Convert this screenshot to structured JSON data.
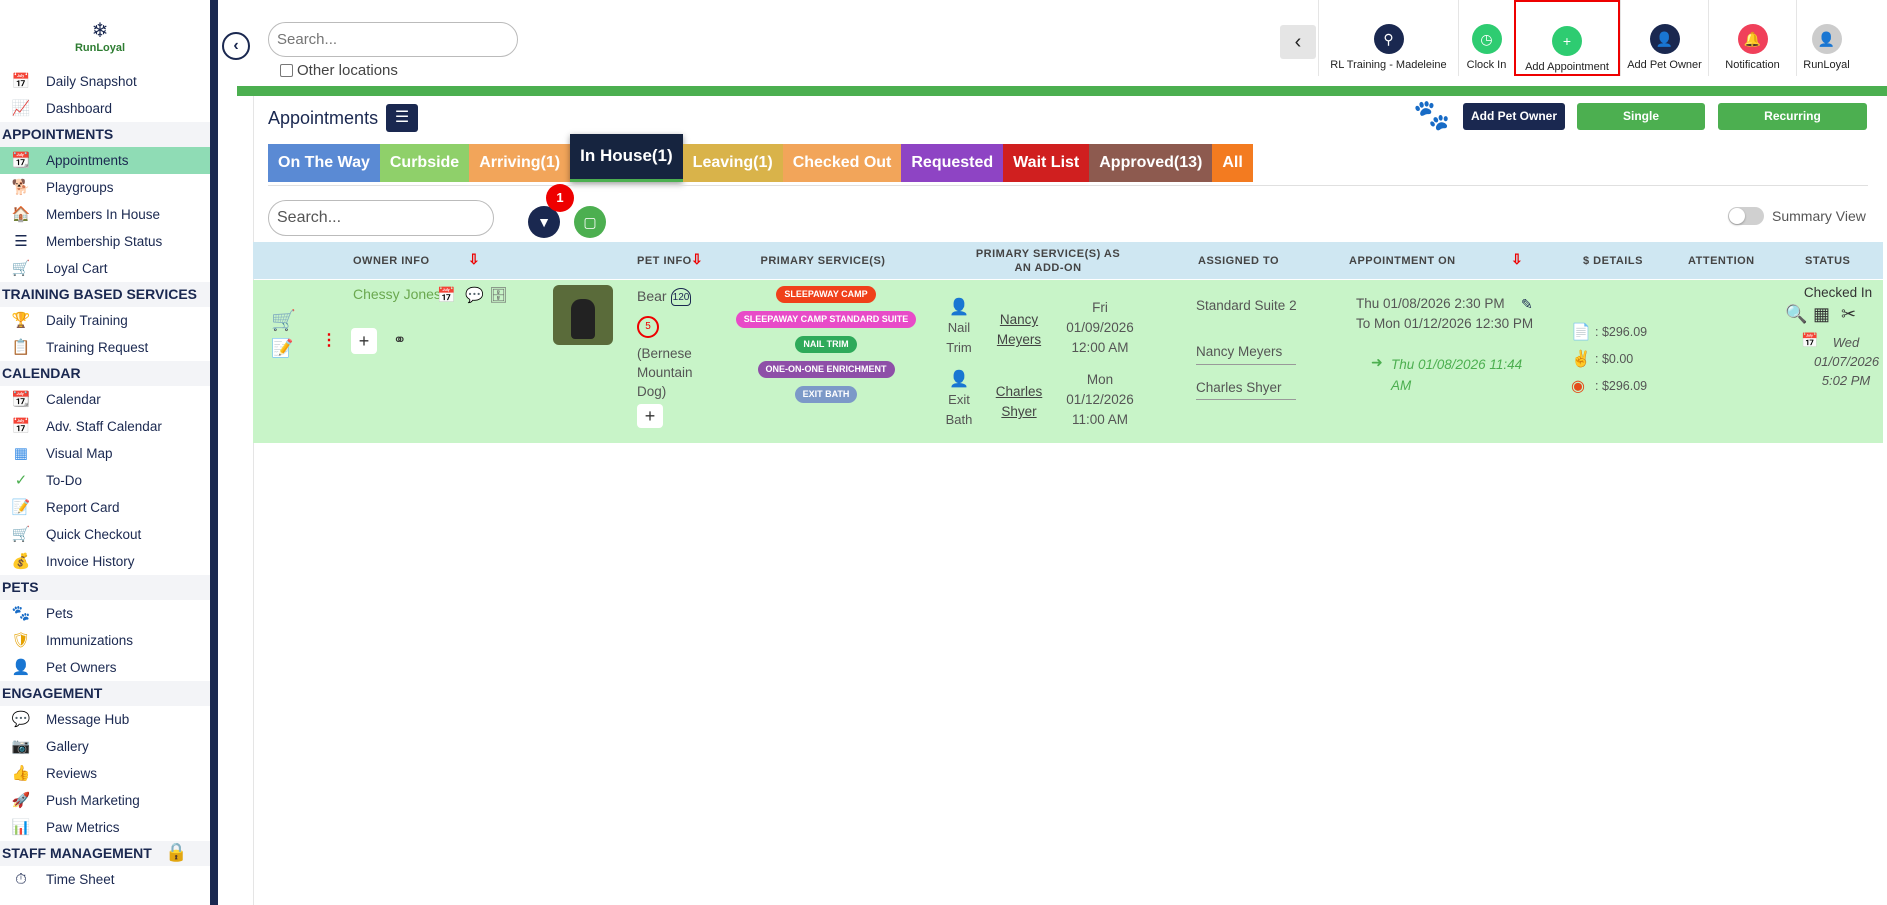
{
  "sidebar": {
    "logo_text": "RunLoyal",
    "sections": [
      {
        "title": "",
        "items": [
          {
            "label": "Daily Snapshot",
            "icon": "today-icon"
          },
          {
            "label": "Dashboard",
            "icon": "dashboard-icon"
          }
        ]
      },
      {
        "title": "APPOINTMENTS",
        "items": [
          {
            "label": "Appointments",
            "icon": "calendar-icon"
          },
          {
            "label": "Playgroups",
            "icon": "dog-icon"
          },
          {
            "label": "Members In House",
            "icon": "house-icon"
          },
          {
            "label": "Membership Status",
            "icon": "membership-icon"
          },
          {
            "label": "Loyal Cart",
            "icon": "cart-icon"
          }
        ]
      },
      {
        "title": "TRAINING BASED SERVICES",
        "items": [
          {
            "label": "Daily Training",
            "icon": "training-icon"
          },
          {
            "label": "Training Request",
            "icon": "request-icon"
          }
        ]
      },
      {
        "title": "CALENDAR",
        "items": [
          {
            "label": "Calendar",
            "icon": "calendar-icon"
          },
          {
            "label": "Adv. Staff Calendar",
            "icon": "staff-calendar-icon"
          },
          {
            "label": "Visual Map",
            "icon": "map-icon"
          },
          {
            "label": "To-Do",
            "icon": "todo-icon"
          },
          {
            "label": "Report Card",
            "icon": "report-icon"
          },
          {
            "label": "Quick Checkout",
            "icon": "checkout-icon"
          },
          {
            "label": "Invoice History",
            "icon": "invoice-icon"
          }
        ]
      },
      {
        "title": "PETS",
        "items": [
          {
            "label": "Pets",
            "icon": "paw-icon"
          },
          {
            "label": "Immunizations",
            "icon": "shield-icon"
          },
          {
            "label": "Pet Owners",
            "icon": "user-icon"
          }
        ]
      },
      {
        "title": "ENGAGEMENT",
        "items": [
          {
            "label": "Message Hub",
            "icon": "message-icon"
          },
          {
            "label": "Gallery",
            "icon": "gallery-icon"
          },
          {
            "label": "Reviews",
            "icon": "thumbs-up-icon"
          },
          {
            "label": "Push Marketing",
            "icon": "rocket-icon"
          },
          {
            "label": "Paw Metrics",
            "icon": "metrics-icon"
          }
        ]
      },
      {
        "title": "STAFF MANAGEMENT",
        "items": [
          {
            "label": "Time Sheet",
            "icon": "timesheet-icon"
          }
        ]
      }
    ]
  },
  "topbar": {
    "search_placeholder": "Search...",
    "other_locations": "Other locations",
    "actions": [
      {
        "label": "RL Training - Madeleine",
        "color": "#1a2850",
        "icon": "location-icon"
      },
      {
        "label": "Clock In",
        "color": "#2ecc71",
        "icon": "clock-icon"
      },
      {
        "label": "Add Appointment",
        "color": "#2ecc71",
        "icon": "add-appointment-icon"
      },
      {
        "label": "Add Pet Owner",
        "color": "#1a2850",
        "icon": "add-user-icon"
      },
      {
        "label": "Notification",
        "color": "#f0405a",
        "icon": "bell-icon"
      },
      {
        "label": "RunLoyal",
        "color": "#cccccc",
        "icon": "avatar-icon"
      }
    ]
  },
  "panel": {
    "title": "Appointments",
    "buttons": {
      "add_owner": "Add Pet Owner",
      "single": "Single Appointment",
      "recurring": "Recurring Appointment"
    },
    "tabs": [
      {
        "label": "On The Way",
        "color": "#5a8ad4"
      },
      {
        "label": "Curbside",
        "color": "#8fd06a"
      },
      {
        "label": "Arriving(1)",
        "color": "#f2a55a"
      },
      {
        "label": "In House(1)",
        "color": "#16243f"
      },
      {
        "label": "Leaving(1)",
        "color": "#d9b34a"
      },
      {
        "label": "Checked Out",
        "color": "#f2a55a"
      },
      {
        "label": "Requested",
        "color": "#8e44c4"
      },
      {
        "label": "Wait List",
        "color": "#d01f1f"
      },
      {
        "label": "Approved(13)",
        "color": "#8d5a4f"
      },
      {
        "label": "All",
        "color": "#f37b20"
      }
    ],
    "table_search_placeholder": "Search...",
    "filter_count": "1",
    "summary_view": "Summary View"
  },
  "table": {
    "headers": {
      "owner": "OWNER INFO",
      "pet": "PET INFO",
      "primary": "PRIMARY SERVICE(S)",
      "addon": "PRIMARY SERVICE(S) AS AN ADD-ON",
      "assigned": "ASSIGNED TO",
      "appt": "APPOINTMENT ON",
      "details": "$ DETAILS",
      "attention": "ATTENTION",
      "status": "STATUS"
    },
    "row": {
      "owner_name": "Chessy Jones",
      "pet_name": "Bear",
      "pet_weight": "120",
      "pet_age": "5",
      "pet_breed": "(Bernese Mountain Dog)",
      "services": [
        {
          "label": "SLEEPAWAY CAMP",
          "color": "#f0401a"
        },
        {
          "label": "SLEEPAWAY CAMP STANDARD SUITE",
          "color": "#e84bc8"
        },
        {
          "label": "NAIL TRIM",
          "color": "#2eaa5a"
        },
        {
          "label": "ONE-ON-ONE ENRICHMENT",
          "color": "#8e4fa8"
        },
        {
          "label": "EXIT BATH",
          "color": "#7c99c8"
        }
      ],
      "addons": [
        {
          "service": "Nail Trim",
          "staff": "Nancy Meyers",
          "day": "Fri",
          "date": "01/09/2026",
          "time": "12:00 AM"
        },
        {
          "service": "Exit Bath",
          "staff": "Charles Shyer",
          "day": "Mon",
          "date": "01/12/2026",
          "time": "11:00 AM"
        }
      ],
      "assigned": [
        "Standard Suite 2",
        "Nancy Meyers",
        "Charles Shyer"
      ],
      "appt_start": "Thu 01/08/2026 2:30 PM",
      "appt_end": "To Mon 01/12/2026 12:30 PM",
      "checkin_time": "Thu 01/08/2026 11:44 AM",
      "details": [
        ": $296.09",
        ": $0.00",
        ": $296.09"
      ],
      "status": "Checked In",
      "status_time": "Wed 01/07/2026 5:02 PM"
    }
  }
}
